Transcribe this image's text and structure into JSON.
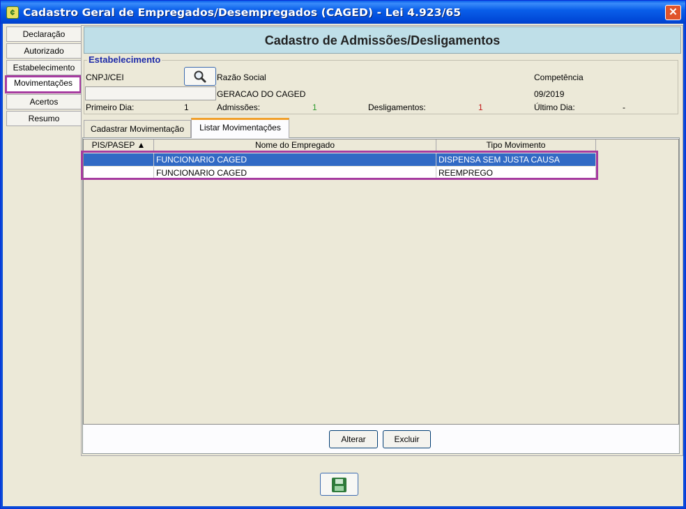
{
  "window": {
    "title": "Cadastro Geral de Empregados/Desempregados (CAGED) - Lei 4.923/65"
  },
  "sidebar": {
    "items": [
      {
        "label": "Declaração"
      },
      {
        "label": "Autorizado"
      },
      {
        "label": "Estabelecimento"
      },
      {
        "label": "Movimentações",
        "active": true
      },
      {
        "label": "Acertos"
      },
      {
        "label": "Resumo"
      }
    ]
  },
  "header": {
    "title": "Cadastro de Admissões/Desligamentos"
  },
  "estabelecimento": {
    "legend": "Estabelecimento",
    "cnpj_label": "CNPJ/CEI",
    "cnpj_value": "",
    "razao_label": "Razão Social",
    "razao_value": "GERACAO DO CAGED",
    "competencia_label": "Competência",
    "competencia_value": "09/2019",
    "primeiro_dia_label": "Primeiro Dia:",
    "primeiro_dia_value": "1",
    "admissoes_label": "Admissões:",
    "admissoes_value": "1",
    "desligamentos_label": "Desligamentos:",
    "desligamentos_value": "1",
    "ultimo_dia_label": "Último Dia:",
    "ultimo_dia_value": "-"
  },
  "tabs": [
    {
      "label": "Cadastrar Movimentação"
    },
    {
      "label": "Listar Movimentações",
      "active": true
    }
  ],
  "table": {
    "columns": [
      "PIS/PASEP ▲",
      "Nome do Empregado",
      "Tipo Movimento"
    ],
    "rows": [
      {
        "pis": "",
        "nome": "FUNCIONARIO CAGED",
        "tipo": "DISPENSA SEM JUSTA CAUSA",
        "selected": true
      },
      {
        "pis": "",
        "nome": "FUNCIONARIO CAGED",
        "tipo": "REEMPREGO",
        "selected": false
      }
    ]
  },
  "buttons": {
    "alterar": "Alterar",
    "excluir": "Excluir"
  },
  "icons": {
    "app": "caged-app-icon",
    "search": "magnifier-icon",
    "save": "floppy-disk-icon",
    "close": "close-icon"
  },
  "colors": {
    "titlebar": "#0A5FEA",
    "header": "#BFDFE8",
    "selection": "#316AC5",
    "annotation": "#A63BA0",
    "admissoes": "#2E9A2E",
    "desligamentos": "#C21A1A"
  }
}
